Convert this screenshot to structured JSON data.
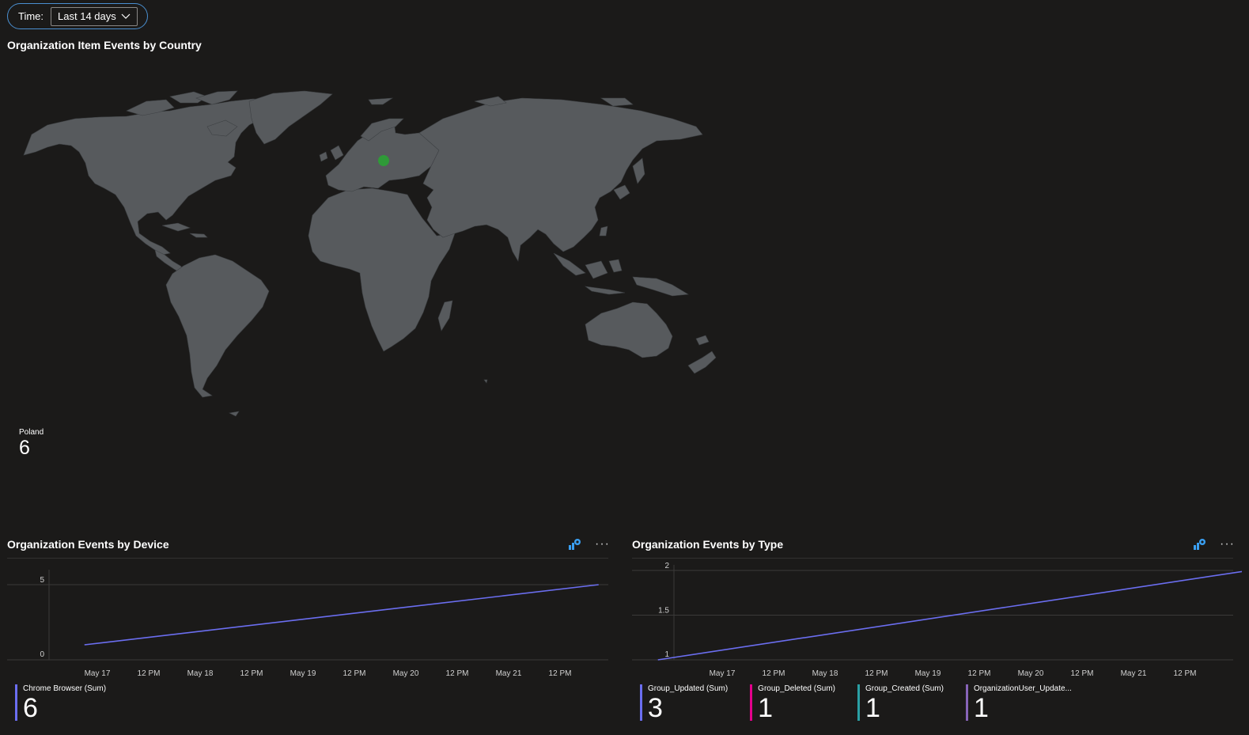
{
  "time_filter": {
    "label": "Time:",
    "value": "Last 14 days"
  },
  "map_tile": {
    "title": "Organization Item Events by Country",
    "legend": {
      "name": "Poland",
      "value": "6"
    },
    "point_color": "#2f9a38",
    "land_color": "#575a5d"
  },
  "device_tile": {
    "title": "Organization Events by Device",
    "icons": [
      "insights-icon",
      "more-icon"
    ],
    "more_label": "···",
    "chart_data": {
      "type": "line",
      "x": [
        "May 16 21:00",
        "May 21 21:00"
      ],
      "x_tick_labels": [
        "May 17",
        "12 PM",
        "May 18",
        "12 PM",
        "May 19",
        "12 PM",
        "May 20",
        "12 PM",
        "May 21",
        "12 PM"
      ],
      "y_tick_labels": [
        "0",
        "5"
      ],
      "ylim": [
        0,
        5
      ],
      "series": [
        {
          "name": "Chrome Browser (Sum)",
          "values": [
            1,
            5
          ],
          "color": "#6b6ef0"
        }
      ]
    },
    "legend": [
      {
        "name": "Chrome Browser (Sum)",
        "value": "6",
        "color": "#6b6ef0"
      }
    ]
  },
  "type_tile": {
    "title": "Organization Events by Type",
    "icons": [
      "insights-icon",
      "more-icon"
    ],
    "more_label": "···",
    "chart_data": {
      "type": "line",
      "x": [
        "May 16 09:00",
        "May 22 03:00"
      ],
      "x_tick_labels": [
        "May 17",
        "12 PM",
        "May 18",
        "12 PM",
        "May 19",
        "12 PM",
        "May 20",
        "12 PM",
        "May 21",
        "12 PM"
      ],
      "y_tick_labels": [
        "1",
        "1.5",
        "2"
      ],
      "ylim": [
        1,
        2
      ],
      "series": [
        {
          "name": "Group_Updated (Sum)",
          "values": [
            1,
            2
          ],
          "color": "#6b6ef0"
        }
      ]
    },
    "legend": [
      {
        "name": "Group_Updated (Sum)",
        "value": "3",
        "color": "#6b6ef0"
      },
      {
        "name": "Group_Deleted (Sum)",
        "value": "1",
        "color": "#e3008c"
      },
      {
        "name": "Group_Created (Sum)",
        "value": "1",
        "color": "#2aa0a4"
      },
      {
        "name": "OrganizationUser_Update...",
        "value": "1",
        "color": "#8764b8"
      }
    ]
  }
}
